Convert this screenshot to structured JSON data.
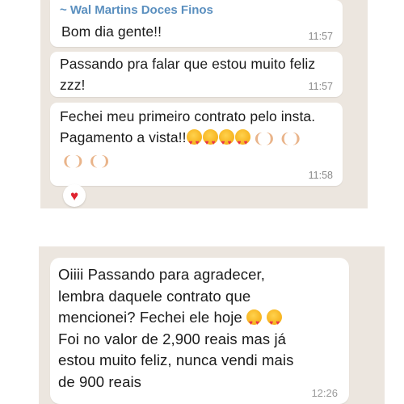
{
  "messages": [
    {
      "sender": "~ Wal Martins Doces Finos",
      "text": "Bom dia gente!!",
      "time": "11:57"
    },
    {
      "line1": "Passando pra falar que estou muito feliz",
      "line2": "zzz!",
      "time": "11:57"
    },
    {
      "line1": "Fechei meu primeiro contrato pelo insta.",
      "line2": "Pagamento a vista!!",
      "emojis": [
        "smiling-face-with-hearts",
        "smiling-face-with-hearts",
        "smiling-face-with-hearts",
        "smiling-face-with-hearts",
        "folded-hands",
        "folded-hands",
        "folded-hands",
        "folded-hands"
      ],
      "time": "11:58",
      "reaction": "red-heart"
    },
    {
      "line1": "Oiiii Passando para agradecer,",
      "line2": "lembra daquele contrato que",
      "line3": "mencionei? Fechei ele hoje",
      "line4": "Foi no valor de 2,900 reais mas já",
      "line5": "estou muito feliz, nunca vendi mais",
      "line6": "de 900 reais",
      "emojis": [
        "smiling-face-with-hearts",
        "smiling-face-with-hearts"
      ],
      "time": "12:26"
    }
  ],
  "colors": {
    "chat_background": "#ece6df",
    "bubble": "#ffffff",
    "sender_name": "#5a8fbf",
    "timestamp": "#8a8a8a",
    "reaction_heart": "#e0232f"
  }
}
